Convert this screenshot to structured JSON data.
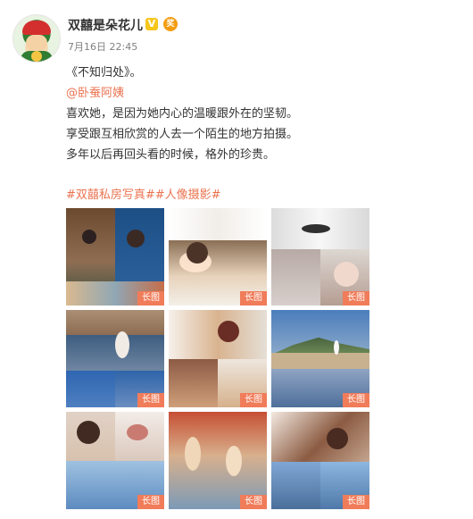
{
  "user": {
    "name": "双囍是朵花儿",
    "verified_badge": "V",
    "medal_badge": "奖"
  },
  "post": {
    "time": "7月16日 22:45",
    "lines": [
      "《不知归处》。",
      "@卧蚕阿姨",
      "喜欢她，是因为她内心的温暖跟外在的坚韧。",
      "享受跟互相欣赏的人去一个陌生的地方拍摄。",
      "多年以后再回头看的时候，格外的珍贵。"
    ],
    "tags": "#双囍私房写真##人像摄影#"
  },
  "images": [
    {
      "label": "长图",
      "scene": "portrait-collage-1"
    },
    {
      "label": "长图",
      "scene": "portrait-collage-2"
    },
    {
      "label": "长图",
      "scene": "portrait-collage-3"
    },
    {
      "label": "长图",
      "scene": "portrait-collage-4"
    },
    {
      "label": "长图",
      "scene": "portrait-collage-5"
    },
    {
      "label": "长图",
      "scene": "portrait-collage-6"
    },
    {
      "label": "长图",
      "scene": "portrait-collage-7"
    },
    {
      "label": "长图",
      "scene": "portrait-collage-8"
    },
    {
      "label": "长图",
      "scene": "portrait-collage-9"
    }
  ],
  "colors": {
    "link": "#eb7350",
    "text": "#333333",
    "meta": "#808080",
    "badge": "#f07c5a"
  }
}
